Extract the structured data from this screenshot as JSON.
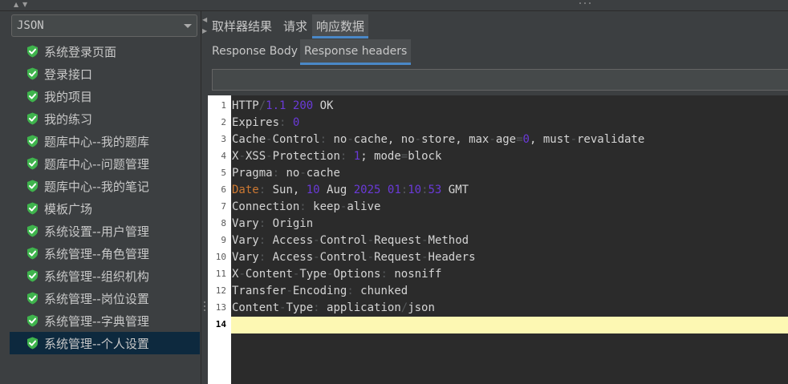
{
  "top_strip": {
    "arrow_up": "▲",
    "arrow_down": "▼"
  },
  "left_panel": {
    "selector": {
      "value": "JSON"
    },
    "tree_items": [
      {
        "label": "系统登录页面"
      },
      {
        "label": "登录接口"
      },
      {
        "label": "我的项目"
      },
      {
        "label": "我的练习"
      },
      {
        "label": "题库中心--我的题库"
      },
      {
        "label": "题库中心--问题管理"
      },
      {
        "label": "题库中心--我的笔记"
      },
      {
        "label": "模板广场"
      },
      {
        "label": "系统设置--用户管理"
      },
      {
        "label": "系统管理--角色管理"
      },
      {
        "label": "系统管理--组织机构"
      },
      {
        "label": "系统管理--岗位设置"
      },
      {
        "label": "系统管理--字典管理"
      },
      {
        "label": "系统管理--个人设置"
      }
    ],
    "selected_index": 13,
    "check_icon": "green-shield-check-icon"
  },
  "splitter": {
    "arrow_left": "◀",
    "arrow_right": "▶"
  },
  "right_panel": {
    "tabs": [
      {
        "label": "取样器结果"
      },
      {
        "label": "请求"
      },
      {
        "label": "响应数据"
      }
    ],
    "active_tab": 2,
    "subtabs": [
      {
        "label": "Response Body"
      },
      {
        "label": "Response headers"
      }
    ],
    "active_subtab": 1,
    "search_value": ""
  },
  "editor": {
    "current_line": 14,
    "lines": [
      {
        "n": "1",
        "text": "HTTP/1.1 200 OK"
      },
      {
        "n": "2",
        "text": "Expires: 0"
      },
      {
        "n": "3",
        "text": "Cache-Control: no-cache, no-store, max-age=0, must-revalidate"
      },
      {
        "n": "4",
        "text": "X-XSS-Protection: 1; mode=block"
      },
      {
        "n": "5",
        "text": "Pragma: no-cache"
      },
      {
        "n": "6",
        "text": "Date: Sun, 10 Aug 2025 01:10:53 GMT"
      },
      {
        "n": "7",
        "text": "Connection: keep-alive"
      },
      {
        "n": "8",
        "text": "Vary: Origin"
      },
      {
        "n": "9",
        "text": "Vary: Access-Control-Request-Method"
      },
      {
        "n": "10",
        "text": "Vary: Access-Control-Request-Headers"
      },
      {
        "n": "11",
        "text": "X-Content-Type-Options: nosniff"
      },
      {
        "n": "12",
        "text": "Transfer-Encoding: chunked"
      },
      {
        "n": "13",
        "text": "Content-Type: application/json"
      },
      {
        "n": "14",
        "text": ""
      }
    ]
  },
  "colors": {
    "accent": "#4a88c7",
    "selection": "#0d293e",
    "check": "#3fb44d",
    "number": "#6a3ad8",
    "date_key": "#cc7832",
    "current_line": "#fdf8b3"
  }
}
